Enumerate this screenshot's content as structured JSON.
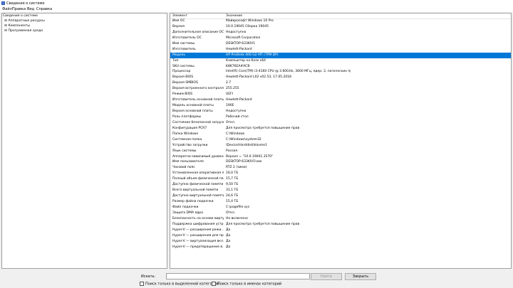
{
  "window": {
    "title": "Сведения о системе"
  },
  "menu": [
    "Файл",
    "Правка",
    "Вид",
    "Справка"
  ],
  "tree": {
    "root": "Сведения о системе",
    "children": [
      "Аппаратные ресурсы",
      "Компоненты",
      "Программная среда"
    ]
  },
  "table": {
    "headers": [
      "Элемент",
      "Значение"
    ],
    "rows": [
      [
        "Имя ОС",
        "Майкрософт Windows 10 Pro"
      ],
      [
        "Версия",
        "10.0.19045 Сборка 19045"
      ],
      [
        "Дополнительное описание ОС",
        "Недоступно"
      ],
      [
        "Изготовитель ОС",
        "Microsoft Corporation"
      ],
      [
        "Имя системы",
        "DESKTOP-633KIV1"
      ],
      [
        "Изготовитель",
        "Hewlett-Packard"
      ],
      [
        "Модель",
        "HP ProDesk 400 G2 MT (TPM DP)"
      ],
      [
        "Тип",
        "Компьютер на базе x64"
      ],
      [
        "SKU системы",
        "K8K76EA#ACB"
      ],
      [
        "Процессор",
        "Intel(R) Core(TM) i3-4160 CPU @ 3.60GHz, 3600 МГц, ядер: 2, логических пр..."
      ],
      [
        "Версия BIOS",
        "Hewlett-Packard L02 v02.53, 17.05.2018"
      ],
      [
        "Версия SMBIOS",
        "2.7"
      ],
      [
        "Версия встроенного контролл...",
        "255.255"
      ],
      [
        "Режим BIOS",
        "UEFI"
      ],
      [
        "Изготовитель основной платы",
        "Hewlett-Packard"
      ],
      [
        "Модель основной платы",
        "190E"
      ],
      [
        "Версия основной платы",
        "Недоступно"
      ],
      [
        "Роль платформы",
        "Рабочий стол"
      ],
      [
        "Состояние безопасной загрузки",
        "Откл."
      ],
      [
        "Конфигурация PCR7",
        "Для просмотра требуется повышение прав"
      ],
      [
        "Папка Windows",
        "C:\\Windows"
      ],
      [
        "Системная папка",
        "C:\\Windows\\system32"
      ],
      [
        "Устройство загрузки",
        "\\Device\\HarddiskVolume1"
      ],
      [
        "Язык системы",
        "Россия"
      ],
      [
        "Аппаратно-зависимый уровень...",
        "Версия = \"10.0.19041.3570\""
      ],
      [
        "Имя пользователя",
        "DESKTOP-633KIV1\\зак"
      ],
      [
        "Часовой пояс",
        "RTZ 2 (зима)"
      ],
      [
        "Установленная оперативная па...",
        "16,0 ГБ"
      ],
      [
        "Полный объем физической пам...",
        "15,7 ГБ"
      ],
      [
        "Доступно физической памяти",
        "9,50 ГБ"
      ],
      [
        "Всего виртуальной памяти",
        "31,1 ГБ"
      ],
      [
        "Доступно виртуальной памяти",
        "24,6 ГБ"
      ],
      [
        "Размер файла подкачки",
        "15,4 ГБ"
      ],
      [
        "Файл подкачки",
        "C:\\pagefile.sys"
      ],
      [
        "Защита DMA ядра",
        "Откл."
      ],
      [
        "Безопасность на основе вирту...",
        "Не включено"
      ],
      [
        "Поддержка шифрования устр...",
        "Для просмотра требуется повышение прав"
      ],
      [
        "Hyper-V — расширения режи...",
        "Да"
      ],
      [
        "Hyper-V — расширения для пр...",
        "Да"
      ],
      [
        "Hyper-V — виртуализация вкл...",
        "Да"
      ],
      [
        "Hyper-V — предотвращение в...",
        "Да"
      ]
    ],
    "selected_index": 6
  },
  "search": {
    "label": "Искать:",
    "value": "",
    "find_button": "Найти",
    "close_button": "Закрыть",
    "check_selected": "Поиск только в выделенной категории",
    "check_names": "Поиск только в именах категорий"
  },
  "colors": {
    "selection": "#0078d7"
  }
}
